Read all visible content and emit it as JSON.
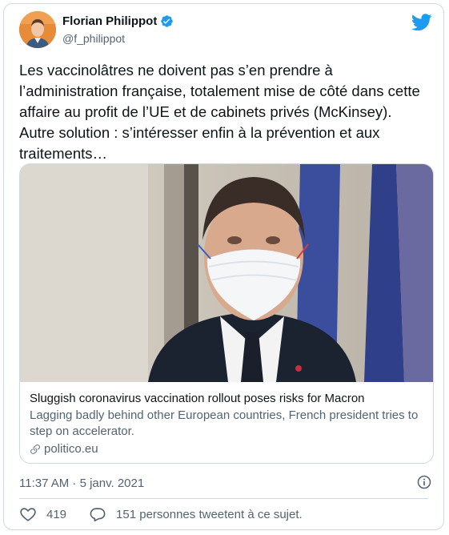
{
  "author": {
    "name": "Florian Philippot",
    "handle": "@f_philippot",
    "verified": true
  },
  "tweet": {
    "text": "Les vaccinolâtres ne doivent pas s’en prendre à\nl’administration française, totalement mise de côté dans cette\naffaire au profit de l’UE et de cabinets privés (McKinsey).\nAutre solution : s’intéresser enfin à la prévention et aux\ntraitements…",
    "timestamp": "11:37 AM · 5 janv. 2021",
    "likes": "419",
    "retweet_text": "151 personnes tweetent à ce sujet."
  },
  "card": {
    "title": "Sluggish coronavirus vaccination rollout poses risks for Macron",
    "description": "Lagging badly behind other European countries, French president tries to step on accelerator.",
    "domain": "politico.eu"
  },
  "colors": {
    "accent": "#1d9bf0",
    "text_primary": "#0f1419",
    "text_secondary": "#536471",
    "border": "#cfd9de"
  },
  "icons": {
    "brand": "twitter-bird-icon",
    "verified": "verified-badge-icon",
    "link": "link-icon",
    "info": "info-icon",
    "like": "heart-icon",
    "reply": "speech-bubble-icon"
  }
}
